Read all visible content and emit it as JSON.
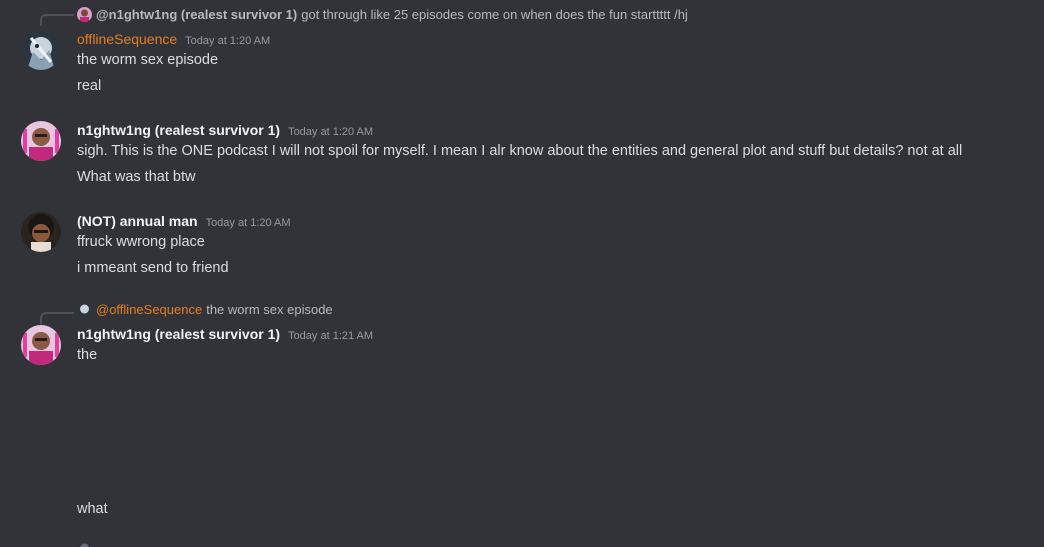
{
  "messages": [
    {
      "reply": {
        "author": "@n1ghtw1ng (realest survivor 1)",
        "text": "got through like 25 episodes come on when does the fun starttttt /hj"
      },
      "author": "offlineSequence",
      "timestamp": "Today at 1:20 AM",
      "lines": [
        "the worm sex episode",
        "real"
      ]
    },
    {
      "author": "n1ghtw1ng (realest survivor 1)",
      "timestamp": "Today at 1:20 AM",
      "lines": [
        "sigh. This is the ONE podcast I will not spoil for myself. I mean I alr know about the entities and general plot and stuff but details? not at all",
        "What was that btw"
      ]
    },
    {
      "author": "(NOT) annual man",
      "timestamp": "Today at 1:20 AM",
      "lines": [
        "ffruck wwrong place",
        "i mmeant send to friend"
      ]
    },
    {
      "reply": {
        "author": "@offlineSequence",
        "text": "the worm sex episode"
      },
      "author": "n1ghtw1ng (realest survivor 1)",
      "timestamp": "Today at 1:21 AM",
      "lines": [
        "the",
        "what"
      ]
    }
  ],
  "colors": {
    "background": "#313338",
    "username_default": "#f2f3f5",
    "username_offline": "#e67e22",
    "text": "#dbdee1",
    "muted": "#949ba4"
  }
}
